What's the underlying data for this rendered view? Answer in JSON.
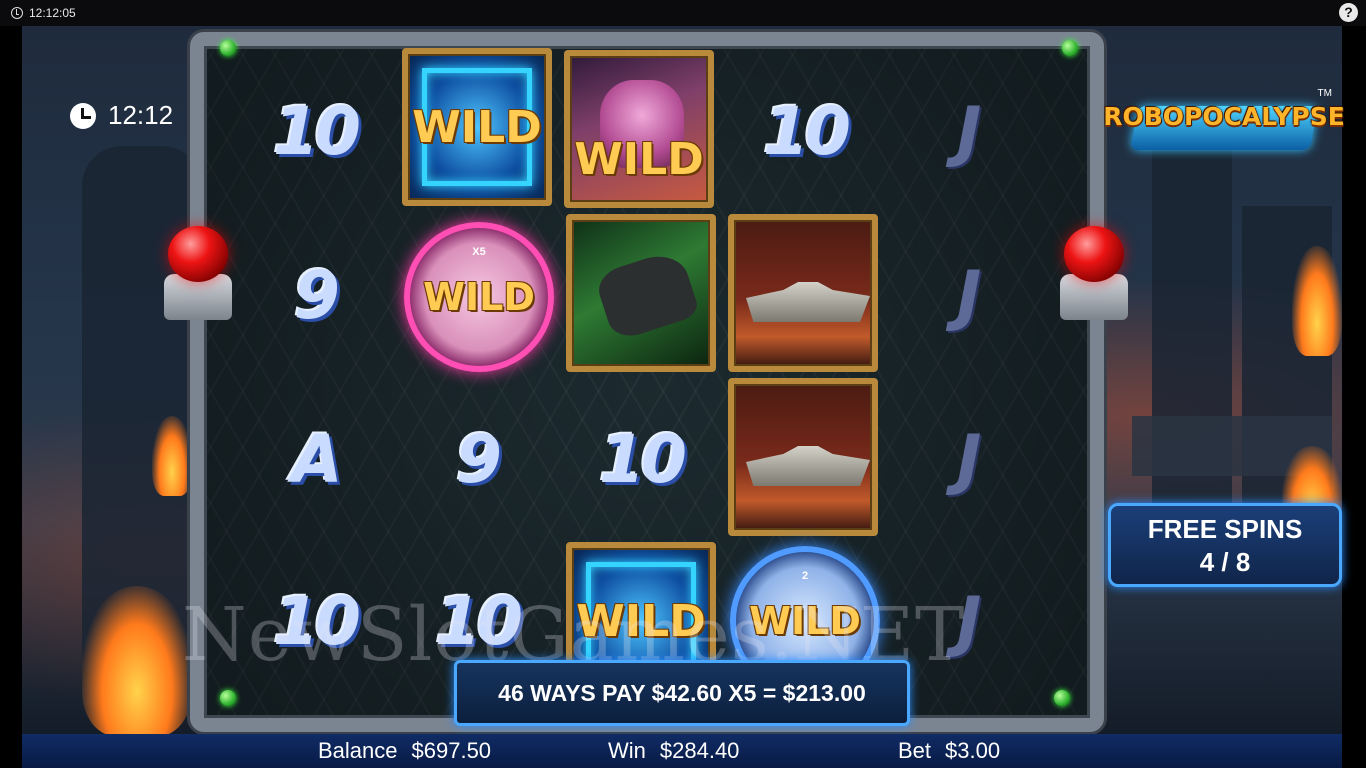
{
  "system_bar": {
    "time": "12:12:05",
    "help_label": "?"
  },
  "game": {
    "timer": "12:12",
    "logo": {
      "title": "ROBOPOCALYPSE",
      "trademark": "TM"
    },
    "free_spins": {
      "label": "FREE SPINS",
      "count": "4 / 8"
    },
    "reels": {
      "r1": {
        "s1": "10",
        "s2": "9",
        "s3": "A",
        "s4": "10"
      },
      "r2": {
        "s1": "WILD",
        "s2_mult": "X5",
        "s2": "WILD",
        "s3": "9",
        "s4": "10"
      },
      "r3": {
        "s1": "WILD",
        "s3": "10",
        "s4": "WILD"
      },
      "r4": {
        "s1": "10",
        "s4_mult": "2",
        "s4": "WILD"
      },
      "r5": {
        "s1": "J",
        "s2": "J",
        "s3": "J",
        "s4": "J"
      }
    },
    "watermark": "NewSlotGames.NET",
    "win_banner": "46 WAYS PAY $42.60 X5 = $213.00"
  },
  "bottom_bar": {
    "balance_label": "Balance",
    "balance_value": "$697.50",
    "win_label": "Win",
    "win_value": "$284.40",
    "bet_label": "Bet",
    "bet_value": "$3.00"
  }
}
